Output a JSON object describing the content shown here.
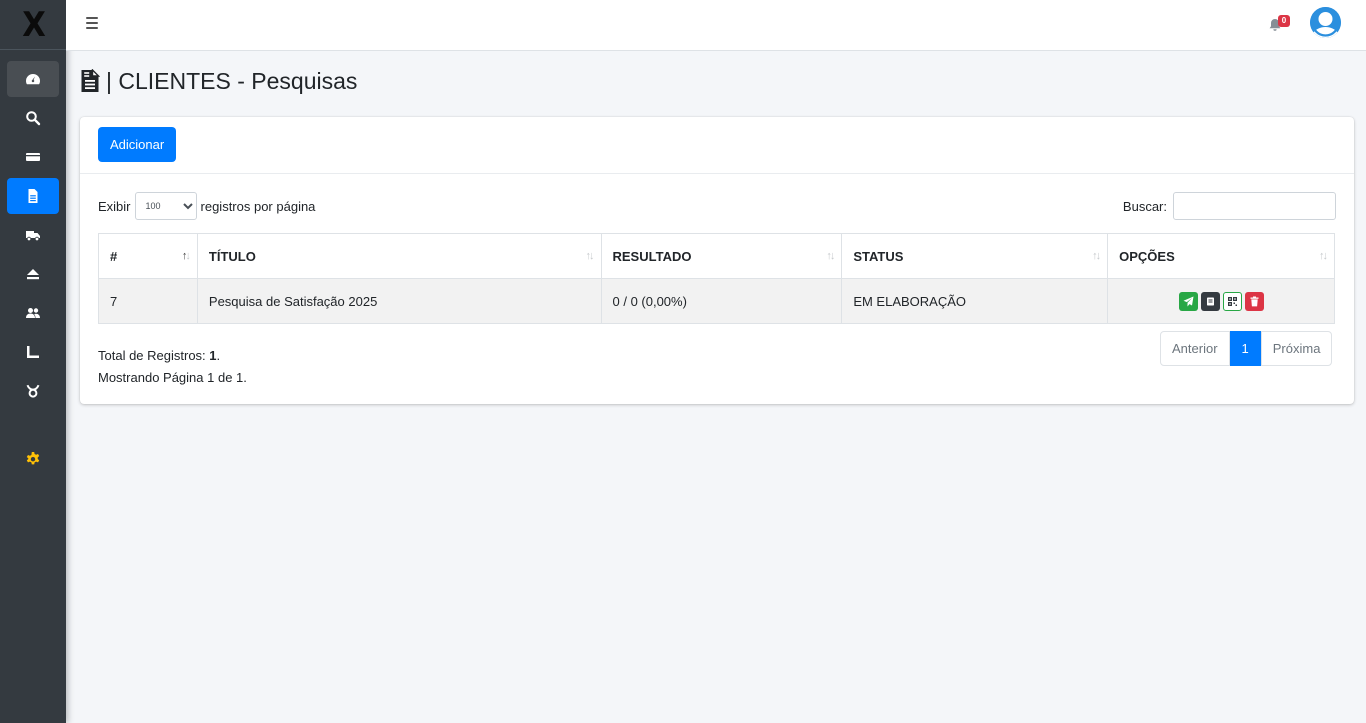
{
  "brand": {
    "logo_text": "X"
  },
  "sidebar": {
    "items": [
      {
        "icon": "tachometer-icon"
      },
      {
        "icon": "search-icon"
      },
      {
        "icon": "id-card-icon"
      },
      {
        "icon": "file-alt-icon"
      },
      {
        "icon": "truck-icon"
      },
      {
        "icon": "eject-icon"
      },
      {
        "icon": "users-icon"
      },
      {
        "icon": "chart-axis-icon"
      },
      {
        "icon": "taurus-icon"
      },
      {
        "icon": "cog-icon"
      }
    ],
    "active_color": "#007bff",
    "cog_color": "#ffc107"
  },
  "topbar": {
    "notifications_count": "0"
  },
  "page": {
    "title": "| CLIENTES - Pesquisas"
  },
  "card": {
    "add_button": "Adicionar",
    "length": {
      "prefix": "Exibir",
      "selected": "100",
      "suffix": "registros por página"
    },
    "search": {
      "label": "Buscar:",
      "value": ""
    },
    "table": {
      "headers": [
        "#",
        "TÍTULO",
        "RESULTADO",
        "STATUS",
        "OPÇÕES"
      ],
      "rows": [
        {
          "id": "7",
          "titulo": "Pesquisa de Satisfação 2025",
          "resultado": "0 / 0 (0,00%)",
          "status": "EM ELABORAÇÃO"
        }
      ]
    },
    "info": {
      "total_label": "Total de Registros:",
      "total_value": "1",
      "page_text": "Mostrando Página 1 de 1."
    },
    "pagination": {
      "prev": "Anterior",
      "current": "1",
      "next": "Próxima"
    }
  }
}
